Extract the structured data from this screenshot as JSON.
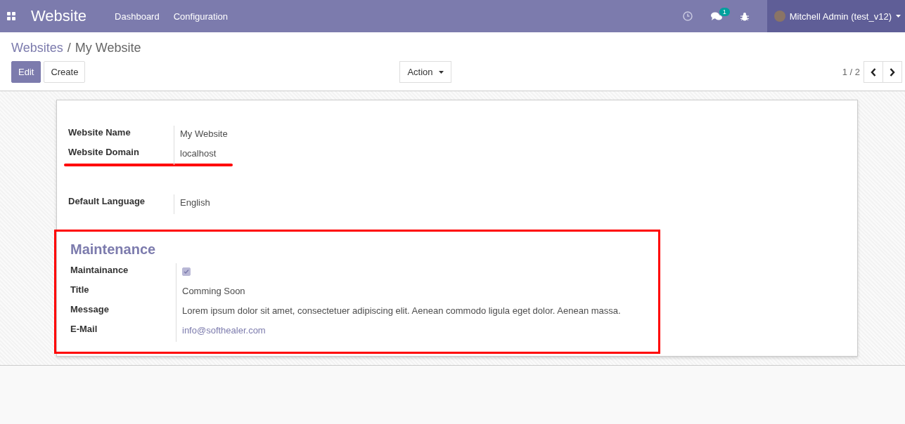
{
  "navbar": {
    "app_title": "Website",
    "menu": [
      {
        "label": "Dashboard"
      },
      {
        "label": "Configuration"
      }
    ],
    "message_count": "1",
    "user": "Mitchell Admin (test_v12)"
  },
  "breadcrumb": [
    {
      "label": "Websites",
      "kind": "link"
    },
    {
      "label": "/",
      "kind": "separator"
    },
    {
      "label": "My Website",
      "kind": "current"
    }
  ],
  "buttons": [
    {
      "label": "Edit",
      "primary": true
    },
    {
      "label": "Create",
      "primary": false
    }
  ],
  "action": {
    "label": "Action"
  },
  "pager": {
    "text": "1 / 2"
  },
  "groups": [
    {
      "underlined": true,
      "fields": [
        {
          "label": "Website Name",
          "kind": "text",
          "value": "My Website"
        },
        {
          "label": "Website Domain",
          "kind": "text",
          "value": "localhost"
        }
      ]
    },
    {
      "fields": [
        {
          "label": "Default Language",
          "kind": "text",
          "value": "English"
        }
      ]
    }
  ],
  "maintenance": {
    "title": "Maintenance",
    "framed": true,
    "fields": [
      {
        "label": "Maintainance",
        "kind": "checkbox",
        "checked": true
      },
      {
        "label": "Title",
        "kind": "text",
        "value": "Comming Soon"
      },
      {
        "label": "Message",
        "kind": "text",
        "value": "Lorem ipsum dolor sit amet, consectetuer adipiscing elit. Aenean commodo ligula eget dolor. Aenean massa."
      },
      {
        "label": "E-Mail",
        "kind": "link",
        "value": "info@softhealer.com"
      }
    ]
  }
}
